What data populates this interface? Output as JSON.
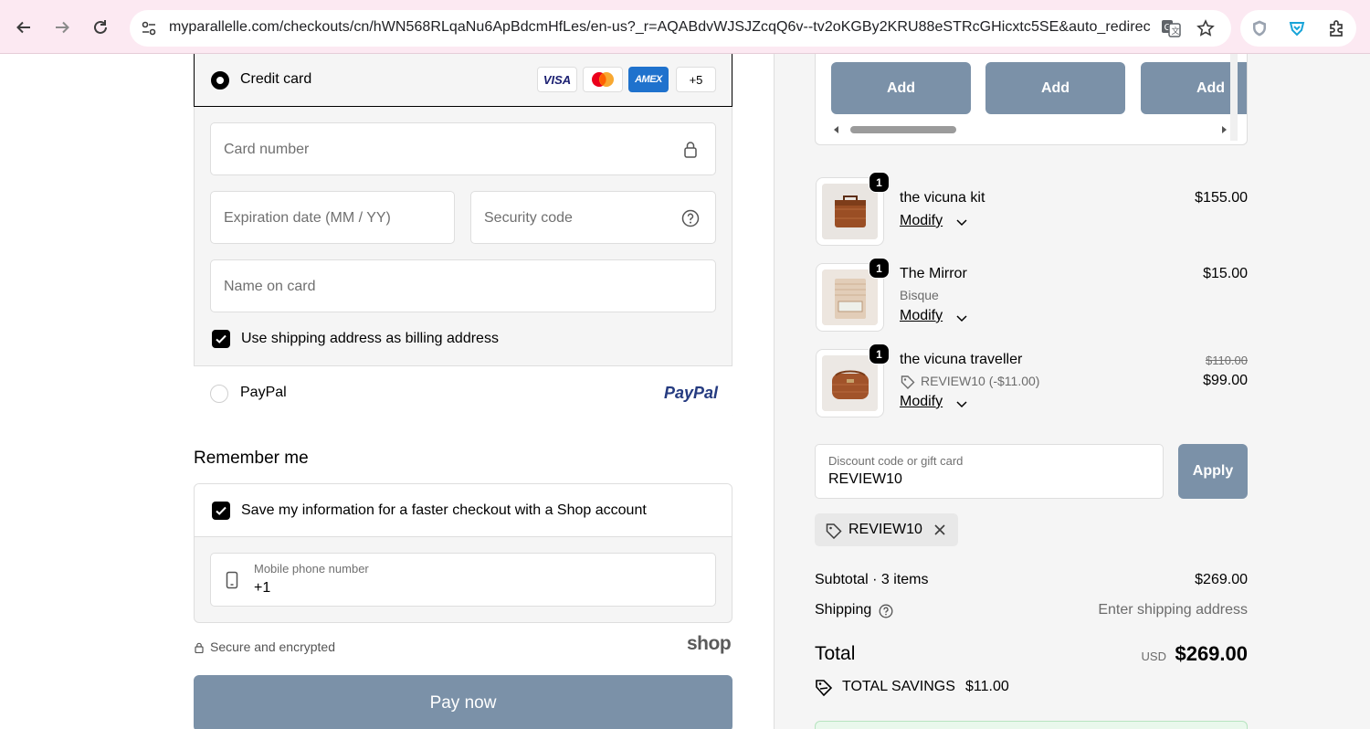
{
  "browser": {
    "url": "myparallelle.com/checkouts/cn/hWN568RLqaNu6ApBdcmHfLes/en-us?_r=AQABdvWJSJZcqQ6v--tv2oKGBy2KRU88eSTRcGHicxtc5SE&auto_redirec...",
    "icons": [
      "back-icon",
      "forward-icon",
      "reload-icon",
      "site-settings-icon",
      "translate-icon",
      "star-icon",
      "shield-extension-icon",
      "vpn-extension-icon",
      "extensions-icon"
    ]
  },
  "payment": {
    "credit_card_label": "Credit card",
    "card_brands": [
      "VISA",
      "AMEX"
    ],
    "more_brands": "+5",
    "card_number_placeholder": "Card number",
    "expiration_placeholder": "Expiration date (MM / YY)",
    "security_code_placeholder": "Security code",
    "name_on_card_placeholder": "Name on card",
    "billing_same_label": "Use shipping address as billing address",
    "paypal_label": "PayPal",
    "paypal_logo": "PayPal"
  },
  "remember_me": {
    "title": "Remember me",
    "save_info_label": "Save my information for a faster checkout with a Shop account",
    "phone_label": "Mobile phone number",
    "phone_value": "+1"
  },
  "secure_text": "Secure and encrypted",
  "shop_logo": "shop",
  "pay_now_label": "Pay now",
  "upsell": {
    "add_labels": [
      "Add",
      "Add",
      "Add"
    ]
  },
  "items": [
    {
      "qty": "1",
      "name": "the vicuna kit",
      "modify": "Modify",
      "price": "$155.00"
    },
    {
      "qty": "1",
      "name": "The Mirror",
      "variant": "Bisque",
      "modify": "Modify",
      "price": "$15.00"
    },
    {
      "qty": "1",
      "name": "the vicuna traveller",
      "discount": "REVIEW10 (-$11.00)",
      "modify": "Modify",
      "original_price": "$110.00",
      "price": "$99.00"
    }
  ],
  "discount": {
    "label": "Discount code or gift card",
    "value": "REVIEW10",
    "apply_label": "Apply",
    "applied_code": "REVIEW10"
  },
  "summary": {
    "subtotal_label": "Subtotal · 3 items",
    "subtotal_value": "$269.00",
    "shipping_label": "Shipping",
    "shipping_value": "Enter shipping address",
    "total_label": "Total",
    "currency": "USD",
    "total_value": "$269.00",
    "savings_label": "TOTAL SAVINGS",
    "savings_value": "$11.00"
  },
  "colors": {
    "button": "#7b91a8",
    "chrome": "#fce9f2",
    "panel": "#f5f5f5"
  }
}
